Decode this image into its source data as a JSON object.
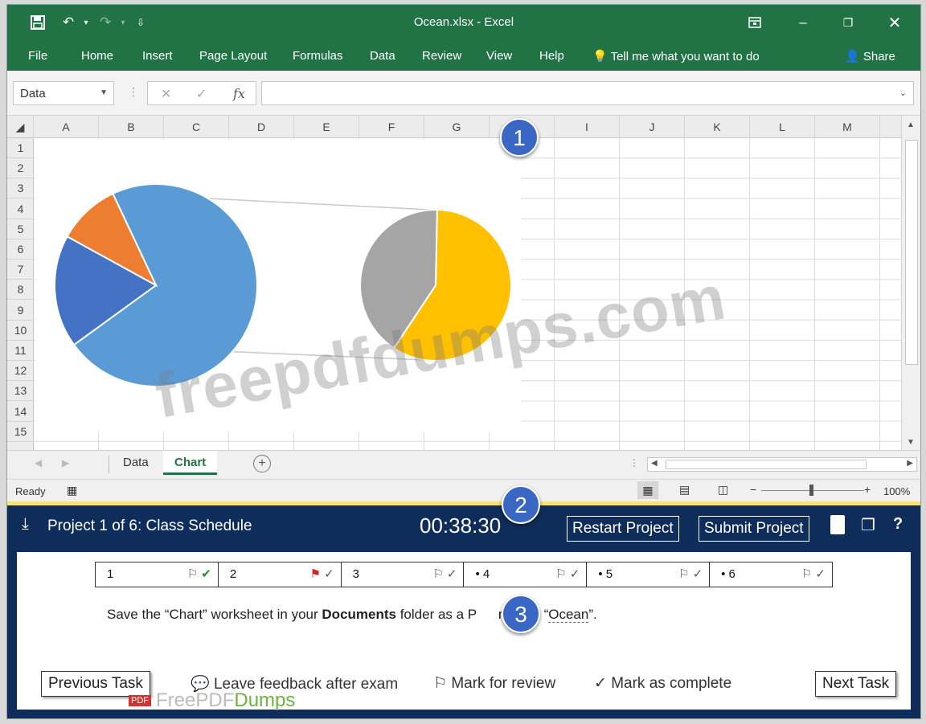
{
  "window": {
    "title": "Ocean.xlsx  -  Excel",
    "accent_color": "#217346"
  },
  "ribbon": {
    "tabs": [
      "File",
      "Home",
      "Insert",
      "Page Layout",
      "Formulas",
      "Data",
      "Review",
      "View",
      "Help"
    ],
    "tell_me": "Tell me what you want to do",
    "share": "Share"
  },
  "formula_bar": {
    "name_box": "Data",
    "fx": "fx",
    "formula": ""
  },
  "grid": {
    "columns": [
      "A",
      "B",
      "C",
      "D",
      "E",
      "F",
      "G",
      "H",
      "I",
      "J",
      "K",
      "L",
      "M"
    ],
    "rows": [
      "1",
      "2",
      "3",
      "4",
      "5",
      "6",
      "7",
      "8",
      "9",
      "10",
      "11",
      "12",
      "13",
      "14",
      "15"
    ]
  },
  "chart_data": {
    "type": "pie",
    "subtype": "pie-of-pie",
    "main_pie_slices": [
      {
        "color": "#5b9bd5",
        "value": 0.72
      },
      {
        "color": "#4472c4",
        "value": 0.18
      },
      {
        "color": "#ed7d31",
        "value": 0.1
      }
    ],
    "secondary_pie_slices": [
      {
        "color": "#ffc000",
        "value": 0.59
      },
      {
        "color": "#a5a5a5",
        "value": 0.41
      }
    ]
  },
  "sheets": {
    "tabs": [
      "Data",
      "Chart"
    ],
    "active": "Chart"
  },
  "status": {
    "ready": "Ready",
    "zoom": "100%"
  },
  "exam": {
    "project_title": "Project 1 of 6: Class Schedule",
    "timer": "00:38:30",
    "restart": "Restart Project",
    "submit": "Submit Project",
    "tasks": [
      {
        "label": "1",
        "flag": "⚐",
        "check": "✔",
        "check_color": "#1e8c3a"
      },
      {
        "label": "2",
        "flag": "⚑",
        "check": "✓",
        "flag_color": "#d42020"
      },
      {
        "label": "3",
        "flag": "⚐",
        "check": "✓"
      },
      {
        "label": "• 4",
        "flag": "⚐",
        "check": "✓"
      },
      {
        "label": "• 5",
        "flag": "⚐",
        "check": "✓"
      },
      {
        "label": "• 6",
        "flag": "⚐",
        "check": "✓"
      }
    ],
    "instruction": {
      "part1": "Save the “Chart” worksheet in your ",
      "bold": "Documents",
      "part2": " folder as a P",
      "part3": " named “",
      "ocean": "Ocean",
      "part4": "”."
    },
    "previous": "Previous Task",
    "feedback": "Leave feedback after exam",
    "mark_review": "Mark for review",
    "mark_complete": "Mark as complete",
    "next": "Next Task"
  },
  "badges": [
    "1",
    "2",
    "3"
  ],
  "watermark": "freepdfdumps.com",
  "logo": {
    "pdf": "PDF",
    "free": "FreePDF",
    "dumps": "Dumps"
  }
}
